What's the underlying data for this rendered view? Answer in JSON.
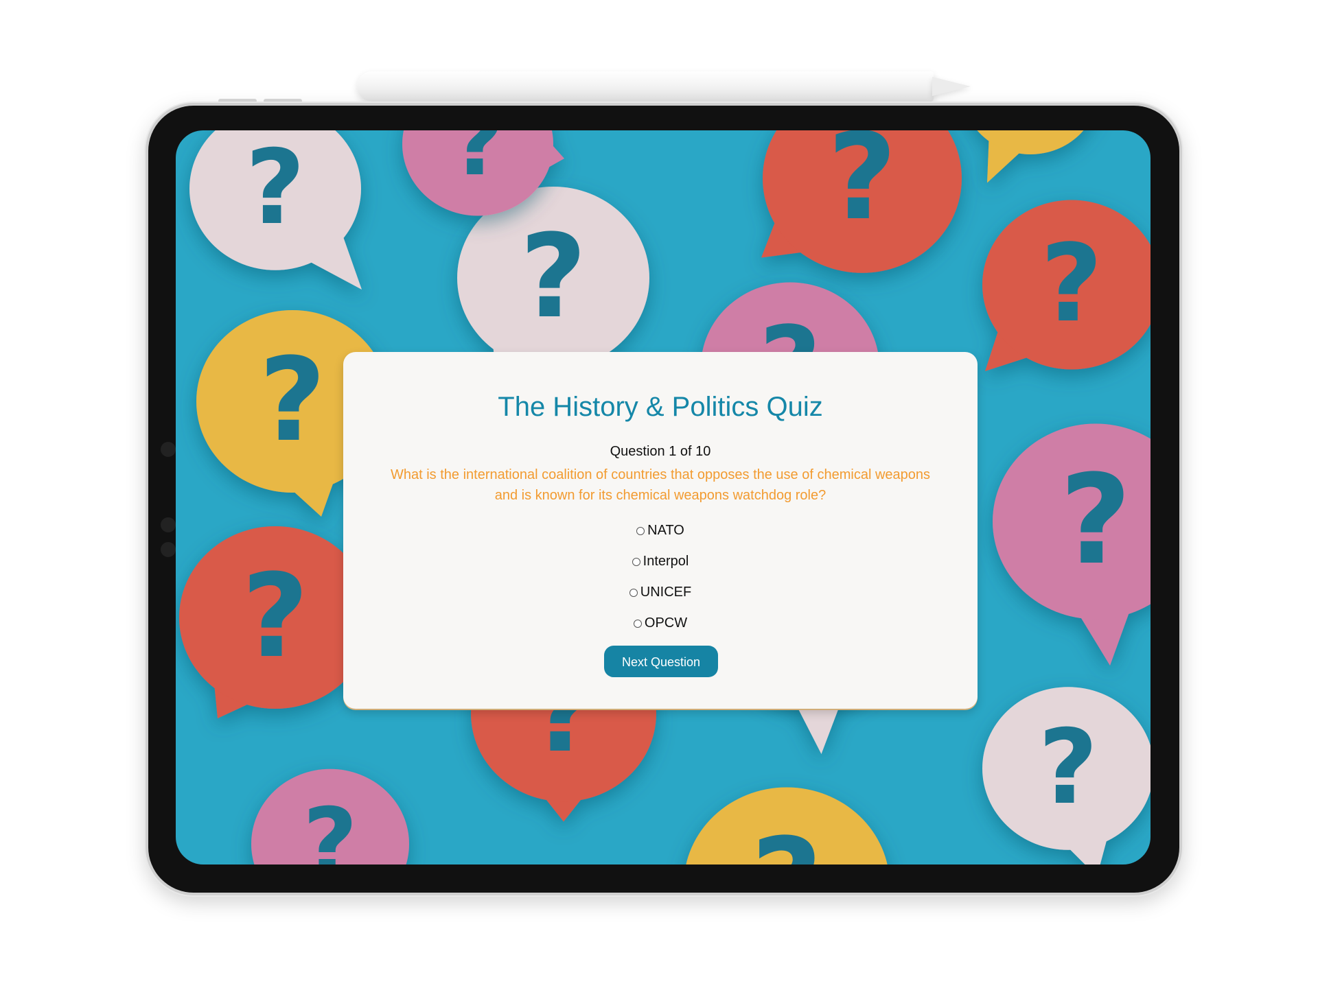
{
  "quiz": {
    "title": "The History & Politics Quiz",
    "counter": "Question 1 of 10",
    "question": "What is the international coalition of countries that opposes the use of chemical weapons and is known for its chemical weapons watchdog role?",
    "options": [
      "NATO",
      "Interpol",
      "UNICEF",
      "OPCW"
    ],
    "next_label": "Next Question"
  },
  "colors": {
    "background": "#2aa7c6",
    "title": "#1587a8",
    "question": "#f29b30",
    "button": "#1684a4",
    "bubble_white": "#e4d6d9",
    "bubble_red": "#d95a48",
    "bubble_yellow": "#e8b844",
    "bubble_pink": "#cf7ea6",
    "question_mark": "#1a7590"
  },
  "icons": [
    "question-mark-bubble-icon"
  ]
}
